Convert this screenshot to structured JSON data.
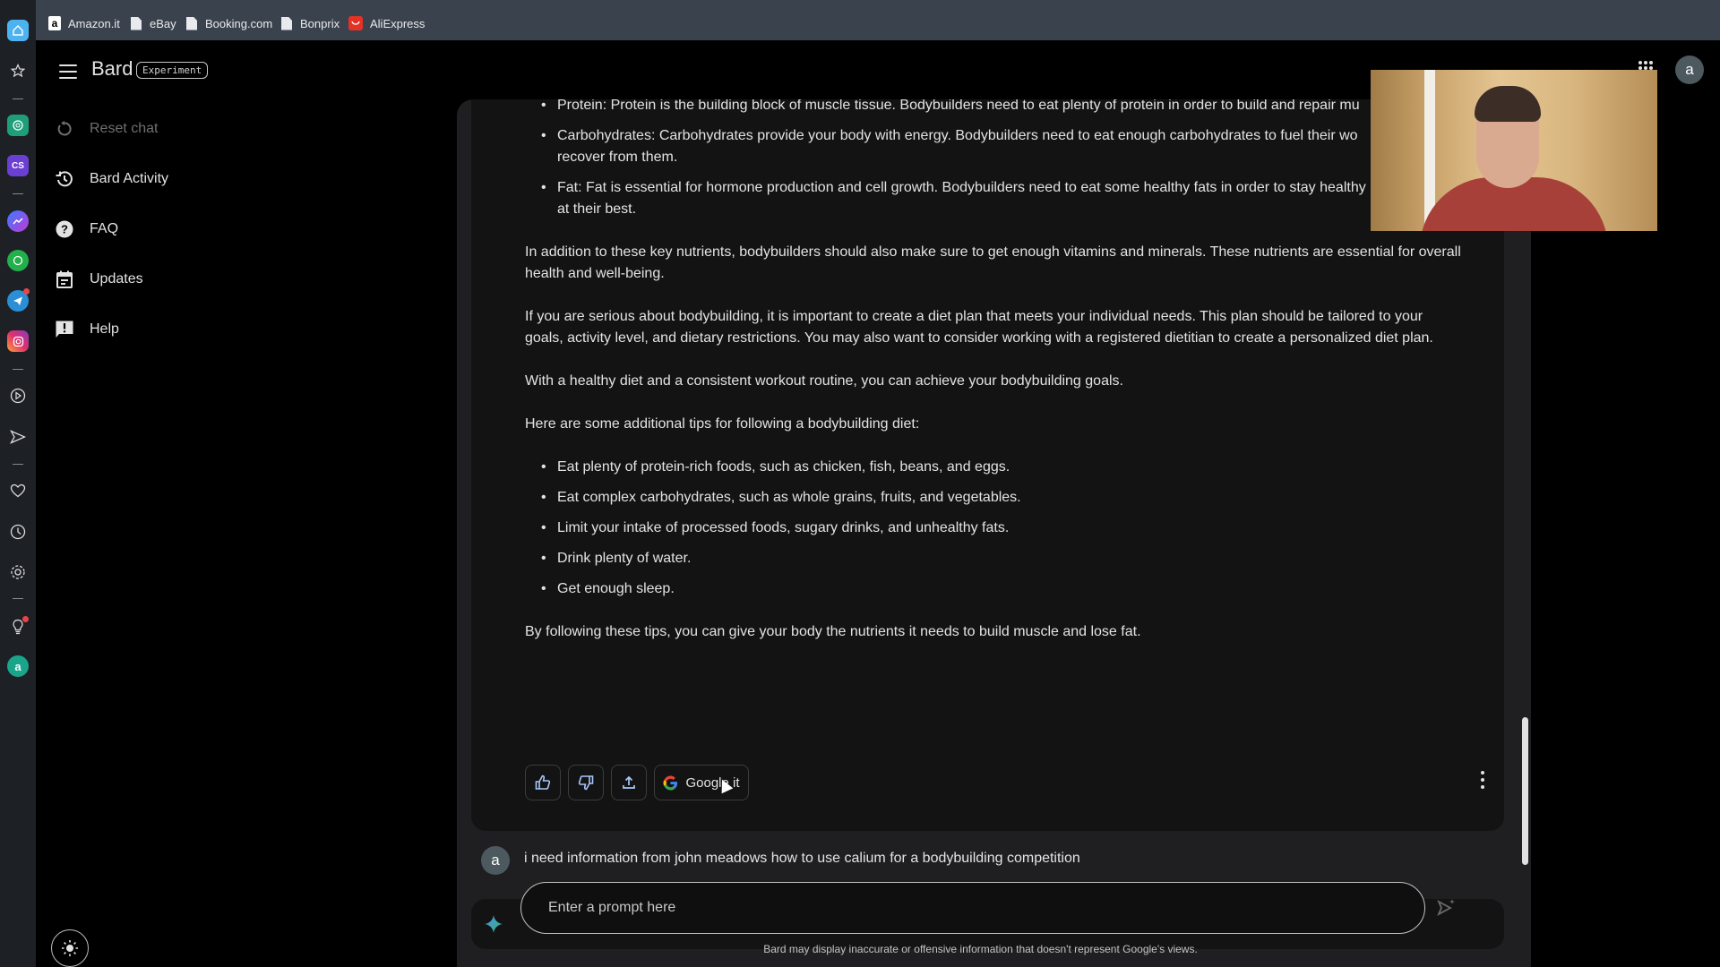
{
  "bookmarks": [
    {
      "label": "Amazon.it",
      "icon": "amazon-icon"
    },
    {
      "label": "eBay",
      "icon": "page-icon"
    },
    {
      "label": "Booking.com",
      "icon": "page-icon"
    },
    {
      "label": "Bonprix",
      "icon": "page-icon"
    },
    {
      "label": "AliExpress",
      "icon": "aliexpress-icon"
    }
  ],
  "rail": {
    "apps": [
      "home",
      "star",
      "chatgpt",
      "cs",
      "messenger",
      "whatsapp",
      "telegram",
      "instagram",
      "player",
      "send",
      "heart",
      "clock",
      "settings",
      "bulb",
      "user-a"
    ],
    "cs_label": "CS",
    "a_label": "a"
  },
  "sidebar": {
    "brand": "Bard",
    "badge": "Experiment",
    "items": [
      {
        "label": "Reset chat",
        "icon": "reset-icon",
        "disabled": true
      },
      {
        "label": "Bard Activity",
        "icon": "history-icon"
      },
      {
        "label": "FAQ",
        "icon": "help-circle-icon"
      },
      {
        "label": "Updates",
        "icon": "calendar-icon"
      },
      {
        "label": "Help",
        "icon": "feedback-icon"
      }
    ]
  },
  "response": {
    "bullets_top": [
      "Protein: Protein is the building block of muscle tissue. Bodybuilders need to eat plenty of protein in order to build and repair mu",
      "Carbohydrates: Carbohydrates provide your body with energy. Bodybuilders need to eat enough carbohydrates to fuel their wo",
      "recover from them.",
      "Fat: Fat is essential for hormone production and cell growth. Bodybuilders need to eat some healthy fats in order to stay healthy",
      "at their best."
    ],
    "paragraphs": [
      "In addition to these key nutrients, bodybuilders should also make sure to get enough vitamins and minerals. These nutrients are essential for overall",
      "health and well-being.",
      "If you are serious about bodybuilding, it is important to create a diet plan that meets your individual needs. This plan should be tailored to your",
      "goals, activity level, and dietary restrictions. You may also want to consider working with a registered dietitian to create a personalized diet plan.",
      "With a healthy diet and a consistent workout routine, you can achieve your bodybuilding goals.",
      "Here are some additional tips for following a bodybuilding diet:"
    ],
    "tips": [
      "Eat plenty of protein-rich foods, such as chicken, fish, beans, and eggs.",
      "Eat complex carbohydrates, such as whole grains, fruits, and vegetables.",
      "Limit your intake of processed foods, sugary drinks, and unhealthy fats.",
      "Drink plenty of water.",
      "Get enough sleep."
    ],
    "closing": "By following these tips, you can give your body the nutrients it needs to build muscle and lose fat.",
    "actions": {
      "google_it": "Google it"
    }
  },
  "user_query": {
    "avatar": "a",
    "text": "i need information from john meadows how to use calium for a bodybuilding competition"
  },
  "prompt": {
    "placeholder": "Enter a prompt here",
    "value": ""
  },
  "disclaimer": "Bard may display inaccurate or offensive information that doesn't represent Google's views.",
  "header": {
    "avatar": "a"
  },
  "colors": {
    "background": "#000000",
    "panel": "#1f1f22",
    "card": "#131314",
    "bookmark_bar": "#3a434d",
    "action_icon": "#a8c7fa"
  }
}
